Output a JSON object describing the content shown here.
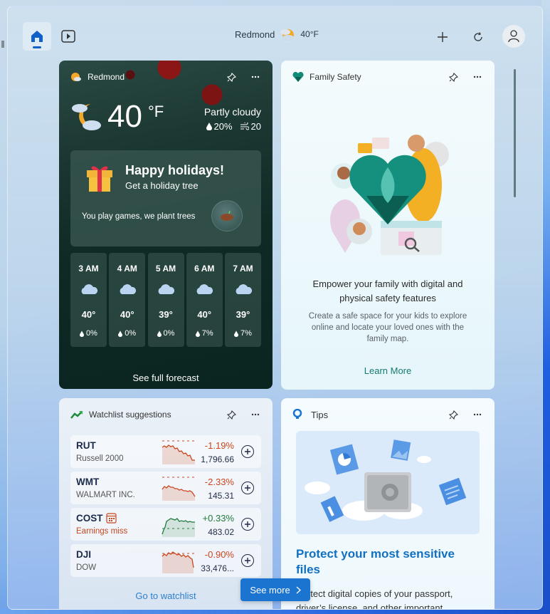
{
  "topbar": {
    "location": "Redmond",
    "temperature": "40°F",
    "tabs": [
      {
        "name": "home",
        "active": true
      },
      {
        "name": "video",
        "active": false
      }
    ]
  },
  "weather": {
    "location": "Redmond",
    "temperature": "40",
    "unit": "°F",
    "condition": "Partly cloudy",
    "precip": "20%",
    "wind": "20",
    "promo": {
      "title": "Happy holidays!",
      "subtitle": "Get a holiday tree",
      "text": "You play games, we plant trees"
    },
    "hourly": [
      {
        "time": "3 AM",
        "temp": "40°",
        "rain": "0%"
      },
      {
        "time": "4 AM",
        "temp": "40°",
        "rain": "0%"
      },
      {
        "time": "5 AM",
        "temp": "39°",
        "rain": "0%"
      },
      {
        "time": "6 AM",
        "temp": "40°",
        "rain": "7%"
      },
      {
        "time": "7 AM",
        "temp": "39°",
        "rain": "7%"
      }
    ],
    "link": "See full forecast"
  },
  "family": {
    "title": "Family Safety",
    "headline": "Empower your family with digital and physical safety features",
    "description": "Create a safe space for your kids to explore online and locate your loved ones with the family map.",
    "link": "Learn More"
  },
  "watchlist": {
    "title": "Watchlist suggestions",
    "stocks": [
      {
        "symbol": "RUT",
        "name": "Russell 2000",
        "change": "-1.19%",
        "price": "1,796.66",
        "direction": "down"
      },
      {
        "symbol": "WMT",
        "name": "WALMART INC.",
        "change": "-2.33%",
        "price": "145.31",
        "direction": "down"
      },
      {
        "symbol": "COST",
        "name": "Earnings miss",
        "change": "+0.33%",
        "price": "483.02",
        "direction": "up",
        "badge": "calendar-icon"
      },
      {
        "symbol": "DJI",
        "name": "DOW",
        "change": "-0.90%",
        "price": "33,476...",
        "direction": "down"
      }
    ],
    "link": "Go to watchlist"
  },
  "tips": {
    "title": "Tips",
    "headline": "Protect your most sensitive files",
    "description": "Protect digital copies of your passport, driver’s license, and other important"
  },
  "see_more": "See more",
  "colors": {
    "accent": "#1a74d0",
    "negative": "#c9461c",
    "positive": "#1f7a3a",
    "family_link": "#157a6e"
  }
}
